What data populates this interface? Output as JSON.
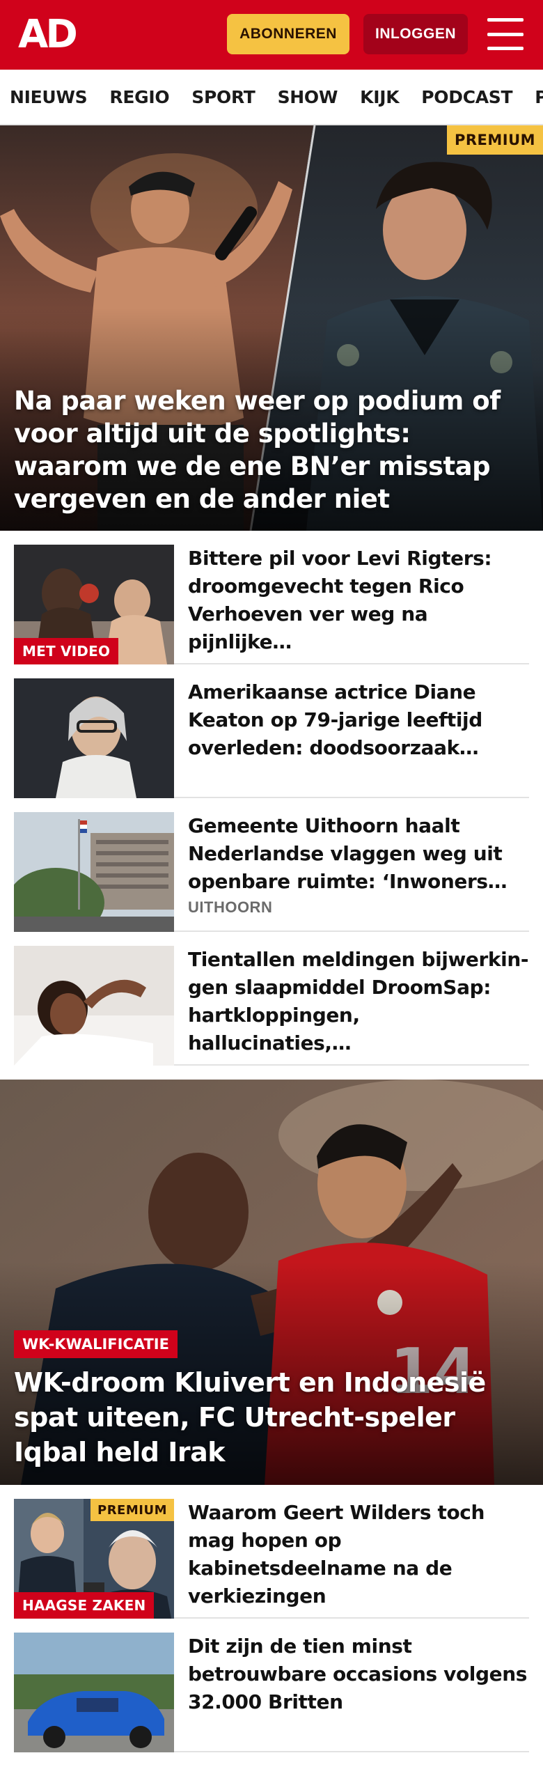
{
  "header": {
    "logo": "AD",
    "subscribe_label": "ABONNEREN",
    "login_label": "INLOGGEN",
    "colors": {
      "brand_red": "#d0021b",
      "premium_yellow": "#f5c242"
    }
  },
  "nav": {
    "items": [
      "NIEUWS",
      "REGIO",
      "SPORT",
      "SHOW",
      "KIJK",
      "PODCAST",
      "PUZZ"
    ]
  },
  "hero": {
    "badge": "PREMIUM",
    "title": "Na paar weken weer op podium of voor altijd uit de spotlights: waarom we de ene BN’er misstap vergeven en de ander niet"
  },
  "articles": [
    {
      "title": "Bittere pil voor Levi Rigters: droomgevecht tegen Rico Verhoeven ver weg na pijnlijke…",
      "tag": "MET VIDEO"
    },
    {
      "title": "Amerikaanse actrice Diane Keaton op 79-jarige leeftijd overleden: doodsoorzaak…"
    },
    {
      "title": "Gemeente Uithoorn haalt Nederlandse vlaggen weg uit openbare ruimte: ‘Inwoners…",
      "meta": "UITHOORN"
    },
    {
      "title": "Tientallen meldingen bijwerkin­gen slaapmiddel DroomSap: hartkloppingen, hallucinaties,…"
    }
  ],
  "hero2": {
    "tag": "WK-KWALIFICATIE",
    "title": "WK-droom Kluivert en Indonesië spat uiteen, FC Utrecht-speler Iqbal held Irak"
  },
  "articles2": [
    {
      "title": "Waarom Geert Wilders toch mag hopen op kabinetsdeelname na de verkiezingen",
      "badge": "PREMIUM",
      "tag": "HAAGSE ZAKEN"
    },
    {
      "title": "Dit zijn de tien minst betrouwba­re occasions volgens 32.000 Britten"
    }
  ]
}
